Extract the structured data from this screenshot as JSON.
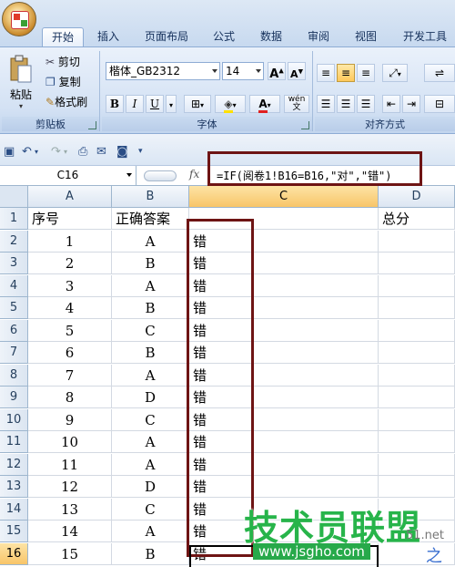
{
  "ribbon": {
    "tabs": [
      {
        "label": "开始",
        "active": true
      },
      {
        "label": "插入"
      },
      {
        "label": "页面布局"
      },
      {
        "label": "公式"
      },
      {
        "label": "数据"
      },
      {
        "label": "审阅"
      },
      {
        "label": "视图"
      },
      {
        "label": "开发工具"
      }
    ],
    "clipboard": {
      "paste": "粘贴",
      "cut": "剪切",
      "copy": "复制",
      "format_painter": "格式刷",
      "group_label": "剪贴板"
    },
    "font": {
      "name": "楷体_GB2312",
      "size": "14",
      "bold": "B",
      "italic": "I",
      "underline": "U",
      "group_label": "字体"
    },
    "alignment": {
      "group_label": "对齐方式"
    }
  },
  "formula_bar": {
    "name_box": "C16",
    "fx": "fx",
    "formula": "=IF(阅卷1!B16=B16,\"对\",\"错\")"
  },
  "sheet": {
    "columns": [
      "A",
      "B",
      "C",
      "D"
    ],
    "selected_column": "C",
    "selected_row": 16,
    "rows": [
      {
        "n": 1,
        "A": "序号",
        "B": "正确答案",
        "C": "",
        "D": "总分"
      },
      {
        "n": 2,
        "A": "1",
        "B": "A",
        "C": "错",
        "D": ""
      },
      {
        "n": 3,
        "A": "2",
        "B": "B",
        "C": "错",
        "D": ""
      },
      {
        "n": 4,
        "A": "3",
        "B": "A",
        "C": "错",
        "D": ""
      },
      {
        "n": 5,
        "A": "4",
        "B": "B",
        "C": "错",
        "D": ""
      },
      {
        "n": 6,
        "A": "5",
        "B": "C",
        "C": "错",
        "D": ""
      },
      {
        "n": 7,
        "A": "6",
        "B": "B",
        "C": "错",
        "D": ""
      },
      {
        "n": 8,
        "A": "7",
        "B": "A",
        "C": "错",
        "D": ""
      },
      {
        "n": 9,
        "A": "8",
        "B": "D",
        "C": "错",
        "D": ""
      },
      {
        "n": 10,
        "A": "9",
        "B": "C",
        "C": "错",
        "D": ""
      },
      {
        "n": 11,
        "A": "10",
        "B": "A",
        "C": "错",
        "D": ""
      },
      {
        "n": 12,
        "A": "11",
        "B": "A",
        "C": "错",
        "D": ""
      },
      {
        "n": 13,
        "A": "12",
        "B": "D",
        "C": "错",
        "D": ""
      },
      {
        "n": 14,
        "A": "13",
        "B": "C",
        "C": "错",
        "D": ""
      },
      {
        "n": 15,
        "A": "14",
        "B": "A",
        "C": "错",
        "D": ""
      },
      {
        "n": 16,
        "A": "15",
        "B": "B",
        "C": "错",
        "D": ""
      }
    ]
  },
  "watermark": {
    "text": "技术员联盟",
    "url": "www.jsgho.com",
    "suffix": "51.net",
    "extra": "之家"
  },
  "colors": {
    "highlight_border": "#6e1414",
    "watermark_green": "#27b44a",
    "selected_header": "#f8c569"
  }
}
